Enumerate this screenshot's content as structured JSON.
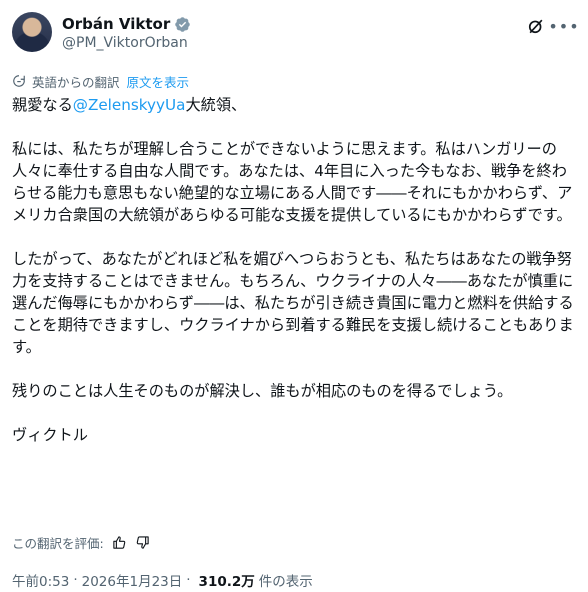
{
  "author": {
    "display_name": "Orbán Viktor",
    "handle": "@PM_ViktorOrban"
  },
  "translation": {
    "label": "英語からの翻訳",
    "show_original": "原文を表示"
  },
  "tweet": {
    "greeting_prefix": "親愛なる",
    "mention": "@ZelenskyyUa",
    "greeting_suffix": "大統領、",
    "paragraph1": "私には、私たちが理解し合うことができないように思えます。私はハンガリーの人々に奉仕する自由な人間です。あなたは、4年目に入った今もなお、戦争を終わらせる能力も意思もない絶望的な立場にある人間です――それにもかかわらず、アメリカ合衆国の大統領があらゆる可能な支援を提供しているにもかかわらずです。",
    "paragraph2": "したがって、あなたがどれほど私を媚びへつらおうとも、私たちはあなたの戦争努力を支持することはできません。もちろん、ウクライナの人々――あなたが慎重に選んだ侮辱にもかかわらず――は、私たちが引き続き貴国に電力と燃料を供給することを期待できますし、ウクライナから到着する難民を支援し続けることもあります。",
    "paragraph3": "残りのことは人生そのものが解決し、誰もが相応のものを得るでしょう。",
    "signature": "ヴィクトル"
  },
  "rating": {
    "label": "この翻訳を評価:"
  },
  "meta": {
    "time": "午前0:53",
    "date": "2026年1月23日",
    "dot": "·",
    "views_count": "310.2万",
    "views_label": "件の表示"
  },
  "icons": {
    "verified": "verified-badge-icon",
    "grok": "grok-icon",
    "more": "more-icon",
    "translate": "translate-icon",
    "thumbs_up": "thumbs-up-icon",
    "thumbs_down": "thumbs-down-icon"
  },
  "colors": {
    "accent": "#1d9bf0",
    "secondary_text": "#536471",
    "primary_text": "#0f1419"
  }
}
